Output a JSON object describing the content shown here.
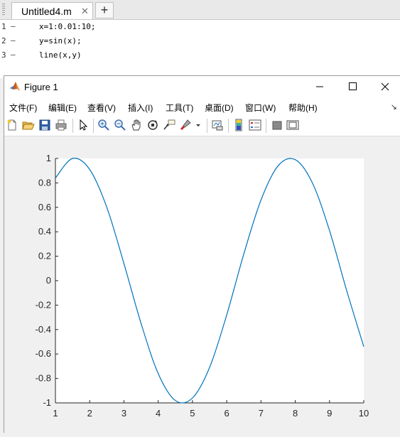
{
  "editor": {
    "tab_label": "Untitled4.m",
    "tab_close": "✕",
    "tab_add": "+",
    "lines": [
      {
        "num": "1",
        "marker": "–",
        "code": "x=1:0.01:10;"
      },
      {
        "num": "2",
        "marker": "–",
        "code": "y=sin(x);"
      },
      {
        "num": "3",
        "marker": "–",
        "code": "line(x,y)"
      }
    ]
  },
  "figure": {
    "title": "Figure 1",
    "menu": [
      "文件(F)",
      "编辑(E)",
      "查看(V)",
      "插入(I)",
      "工具(T)",
      "桌面(D)",
      "窗口(W)",
      "帮助(H)"
    ],
    "menu_more": "↘",
    "toolbar_icons": [
      "new-figure-icon",
      "open-file-icon",
      "save-icon",
      "print-icon",
      "pointer-icon",
      "zoom-in-icon",
      "zoom-out-icon",
      "pan-icon",
      "rotate-3d-icon",
      "data-cursor-icon",
      "brush-icon",
      "brush-dropdown-icon",
      "link-plot-icon",
      "insert-colorbar-icon",
      "insert-legend-icon",
      "hide-plot-tools-icon",
      "show-plot-tools-icon"
    ]
  },
  "chart_data": {
    "type": "line",
    "title": "",
    "xlabel": "",
    "ylabel": "",
    "xlim": [
      1,
      10
    ],
    "ylim": [
      -1,
      1
    ],
    "xticks": [
      "1",
      "2",
      "3",
      "4",
      "5",
      "6",
      "7",
      "8",
      "9",
      "10"
    ],
    "yticks": [
      "-1",
      "-0.8",
      "-0.6",
      "-0.4",
      "-0.2",
      "0",
      "0.2",
      "0.4",
      "0.6",
      "0.8",
      "1"
    ],
    "grid": false,
    "line_color": "#0072bd",
    "series": [
      {
        "x": [
          1,
          1.5,
          2,
          2.5,
          3,
          3.5,
          4,
          4.5,
          5,
          5.5,
          6,
          6.5,
          7,
          7.5,
          8,
          8.5,
          9,
          9.5,
          10
        ],
        "y": [
          0.84,
          1.0,
          0.91,
          0.6,
          0.14,
          -0.35,
          -0.76,
          -0.98,
          -0.96,
          -0.71,
          -0.28,
          0.22,
          0.66,
          0.94,
          0.99,
          0.8,
          0.41,
          -0.08,
          -0.54
        ]
      }
    ]
  }
}
